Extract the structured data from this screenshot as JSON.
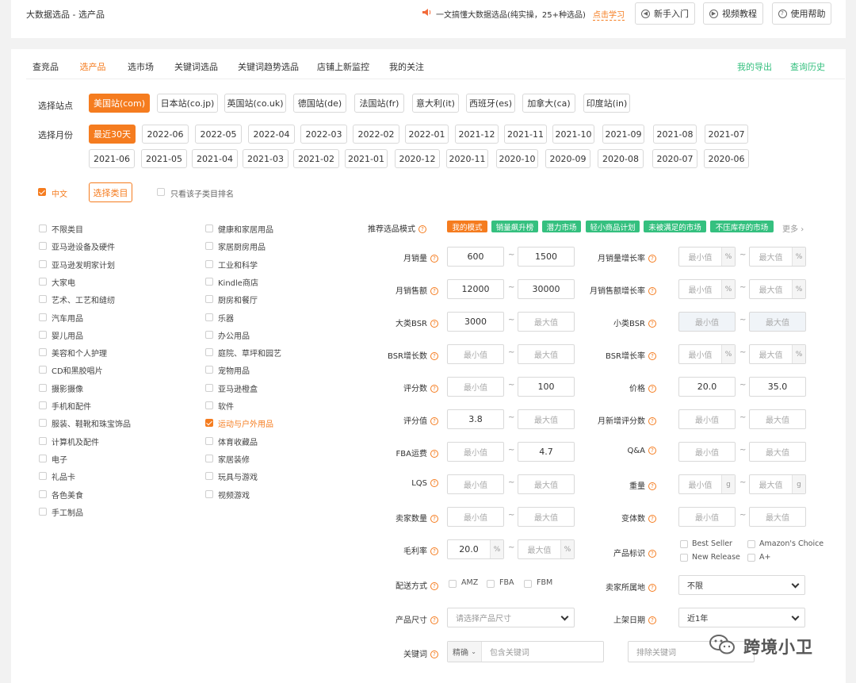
{
  "header": {
    "title": "大数据选品 - 选产品",
    "notice_text": "一文搞懂大数据选品(纯实操，25+种选品)",
    "notice_link": "点击学习",
    "buttons": [
      "新手入门",
      "视频教程",
      "使用帮助"
    ]
  },
  "tabs": [
    "查竞品",
    "选产品",
    "选市场",
    "关键词选品",
    "关键词趋势选品",
    "店铺上新监控",
    "我的关注"
  ],
  "tab_right": {
    "export": "我的导出",
    "history": "查询历史"
  },
  "site": {
    "label": "选择站点",
    "items": [
      "美国站(com)",
      "日本站(co.jp)",
      "英国站(co.uk)",
      "德国站(de)",
      "法国站(fr)",
      "意大利(it)",
      "西班牙(es)",
      "加拿大(ca)",
      "印度站(in)"
    ]
  },
  "month": {
    "label": "选择月份",
    "row1": [
      "最近30天",
      "2022-06",
      "2022-05",
      "2022-04",
      "2022-03",
      "2022-02",
      "2022-01",
      "2021-12",
      "2021-11",
      "2021-10",
      "2021-09",
      "2021-08",
      "2021-07"
    ],
    "row2": [
      "2021-06",
      "2021-05",
      "2021-04",
      "2021-03",
      "2021-02",
      "2021-01",
      "2020-12",
      "2020-11",
      "2020-10",
      "2020-09",
      "2020-08",
      "2020-07",
      "2020-06"
    ]
  },
  "category_bar": {
    "lang": "中文",
    "select_btn": "选择类目",
    "only_sub": "只看该子类目排名"
  },
  "categories_left": [
    "不限类目",
    "亚马逊设备及硬件",
    "亚马逊发明家计划",
    "大家电",
    "艺术、工艺和缝纫",
    "汽车用品",
    "婴儿用品",
    "美容和个人护理",
    "CD和黑胶唱片",
    "摄影摄像",
    "手机和配件",
    "服装、鞋靴和珠宝饰品",
    "计算机及配件",
    "电子",
    "礼品卡",
    "各色美食",
    "手工制品"
  ],
  "categories_right": [
    "健康和家居用品",
    "家居厨房用品",
    "工业和科学",
    "Kindle商店",
    "厨房和餐厅",
    "乐器",
    "办公用品",
    "庭院、草坪和园艺",
    "宠物用品",
    "亚马逊橙盒",
    "软件",
    "运动与户外用品",
    "体育收藏品",
    "家居装修",
    "玩具与游戏",
    "视频游戏"
  ],
  "selected_category": "运动与户外用品",
  "modes": {
    "label": "推荐选品模式",
    "items": [
      {
        "text": "我的模式",
        "color": "#f57c1f"
      },
      {
        "text": "销量飙升榜",
        "color": "#35c07f"
      },
      {
        "text": "潜力市场",
        "color": "#35c07f"
      },
      {
        "text": "轻小商品计划",
        "color": "#35c07f"
      },
      {
        "text": "未被满足的市场",
        "color": "#35c07f"
      },
      {
        "text": "不压库存的市场",
        "color": "#35c07f"
      }
    ],
    "more": "更多"
  },
  "placeholders": {
    "min": "最小值",
    "max": "最大值"
  },
  "filters_left": [
    {
      "label": "月销量",
      "min": "600",
      "max": "1500"
    },
    {
      "label": "月销售额",
      "min": "12000",
      "max": "30000"
    },
    {
      "label": "大类BSR",
      "min": "3000",
      "max": ""
    },
    {
      "label": "BSR增长数",
      "min": "",
      "max": ""
    },
    {
      "label": "评分数",
      "min": "",
      "max": "100"
    },
    {
      "label": "评分值",
      "min": "3.8",
      "max": ""
    },
    {
      "label": "FBA运费",
      "min": "",
      "max": "4.7"
    },
    {
      "label": "LQS",
      "min": "",
      "max": ""
    },
    {
      "label": "卖家数量",
      "min": "",
      "max": ""
    },
    {
      "label": "毛利率",
      "min": "20.0",
      "max": "",
      "unit": "%"
    }
  ],
  "filters_right": [
    {
      "label": "月销量增长率",
      "min": "",
      "max": "",
      "unit": "%"
    },
    {
      "label": "月销售额增长率",
      "min": "",
      "max": "",
      "unit": "%"
    },
    {
      "label": "小类BSR",
      "min": "",
      "max": ""
    },
    {
      "label": "BSR增长率",
      "min": "",
      "max": "",
      "unit": "%"
    },
    {
      "label": "价格",
      "min": "20.0",
      "max": "35.0"
    },
    {
      "label": "月新增评分数",
      "min": "",
      "max": ""
    },
    {
      "label": "Q&A",
      "min": "",
      "max": ""
    },
    {
      "label": "重量",
      "min": "",
      "max": "",
      "unit": "g"
    },
    {
      "label": "变体数",
      "min": "",
      "max": ""
    }
  ],
  "product_tag": {
    "label": "产品标识",
    "options": [
      "Best Seller",
      "Amazon's Choice",
      "New Release",
      "A+"
    ]
  },
  "shipping": {
    "label": "配送方式",
    "options": [
      "AMZ",
      "FBA",
      "FBM"
    ]
  },
  "seller_loc": {
    "label": "卖家所属地",
    "value": "不限"
  },
  "size": {
    "label": "产品尺寸",
    "placeholder": "请选择产品尺寸"
  },
  "listing_date": {
    "label": "上架日期",
    "value": "近1年"
  },
  "keyword": {
    "label": "关键词",
    "mode": "精确",
    "include_ph": "包含关键词",
    "exclude_ph": "排除关键词"
  },
  "watermark": "跨境小卫"
}
